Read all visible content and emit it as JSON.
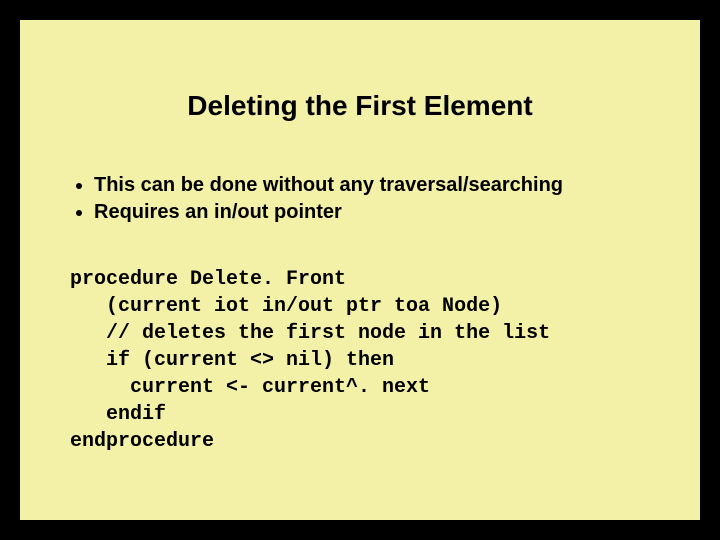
{
  "title": "Deleting the First Element",
  "bullets": [
    "This can be done without any traversal/searching",
    "Requires an in/out pointer"
  ],
  "code": "procedure Delete. Front\n   (current iot in/out ptr toa Node)\n   // deletes the first node in the list\n   if (current <> nil) then\n     current <- current^. next\n   endif\nendprocedure"
}
